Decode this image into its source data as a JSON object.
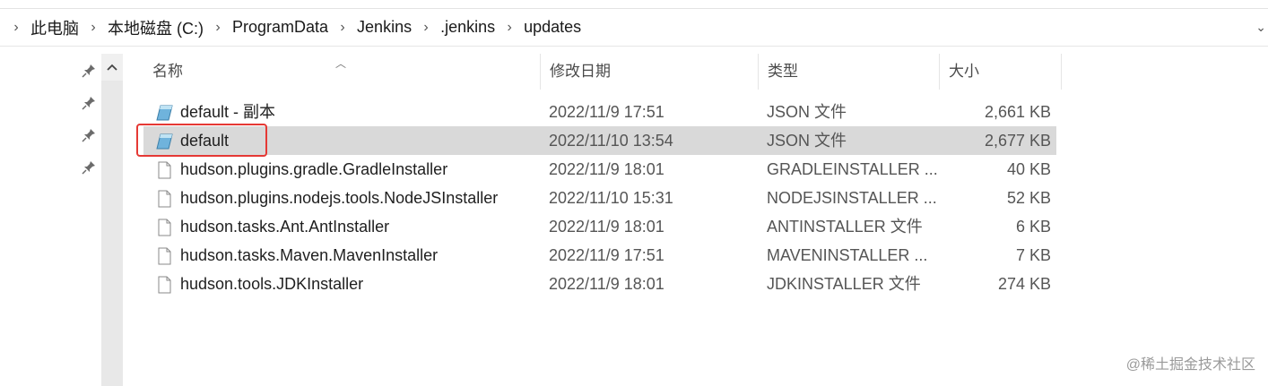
{
  "breadcrumb": {
    "items": [
      "此电脑",
      "本地磁盘 (C:)",
      "ProgramData",
      "Jenkins",
      ".jenkins",
      "updates"
    ]
  },
  "columns": {
    "name": "名称",
    "date": "修改日期",
    "type": "类型",
    "size": "大小"
  },
  "files": [
    {
      "name": "default - 副本",
      "date": "2022/11/9 17:51",
      "type": "JSON 文件",
      "size": "2,661 KB",
      "icon": "json-file-icon"
    },
    {
      "name": "default",
      "date": "2022/11/10 13:54",
      "type": "JSON 文件",
      "size": "2,677 KB",
      "icon": "json-file-icon",
      "selected": true
    },
    {
      "name": "hudson.plugins.gradle.GradleInstaller",
      "date": "2022/11/9 18:01",
      "type": "GRADLEINSTALLER ...",
      "size": "40 KB",
      "icon": "blank-file-icon"
    },
    {
      "name": "hudson.plugins.nodejs.tools.NodeJSInstaller",
      "date": "2022/11/10 15:31",
      "type": "NODEJSINSTALLER ...",
      "size": "52 KB",
      "icon": "blank-file-icon"
    },
    {
      "name": "hudson.tasks.Ant.AntInstaller",
      "date": "2022/11/9 18:01",
      "type": "ANTINSTALLER 文件",
      "size": "6 KB",
      "icon": "blank-file-icon"
    },
    {
      "name": "hudson.tasks.Maven.MavenInstaller",
      "date": "2022/11/9 17:51",
      "type": "MAVENINSTALLER ...",
      "size": "7 KB",
      "icon": "blank-file-icon"
    },
    {
      "name": "hudson.tools.JDKInstaller",
      "date": "2022/11/9 18:01",
      "type": "JDKINSTALLER 文件",
      "size": "274 KB",
      "icon": "blank-file-icon"
    }
  ],
  "watermark": "@稀土掘金技术社区",
  "colors": {
    "selected_row": "#d9d9d9",
    "highlight_box": "#e53935"
  }
}
